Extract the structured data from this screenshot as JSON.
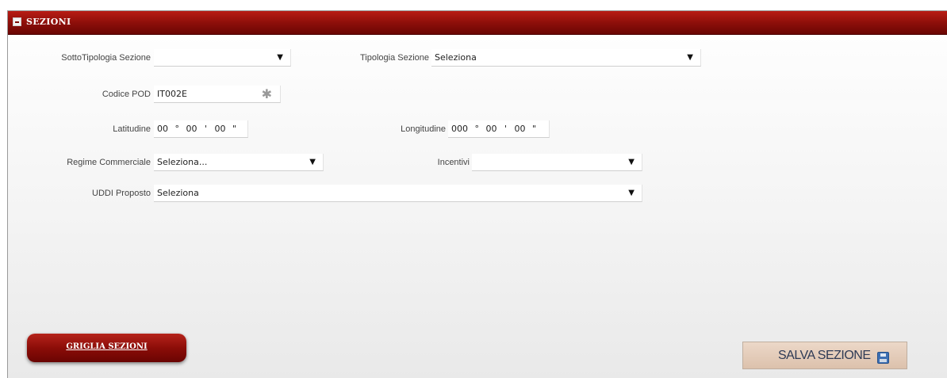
{
  "section": {
    "title": "SEZIONI",
    "icon": "collapse-icon"
  },
  "form": {
    "sottotipologia": {
      "label": "SottoTipologia Sezione",
      "value": ""
    },
    "tipologia": {
      "label": "Tipologia Sezione",
      "value": "Seleziona"
    },
    "codice_pod": {
      "label": "Codice POD",
      "value": "IT002E",
      "required_icon": "asterisk-icon"
    },
    "latitudine": {
      "label": "Latitudine",
      "deg": "00",
      "deg_symbol": "°",
      "min": "00",
      "min_symbol": "'",
      "sec": "00",
      "sec_symbol": "\""
    },
    "longitudine": {
      "label": "Longitudine",
      "deg": "000",
      "deg_symbol": "°",
      "min": "00",
      "min_symbol": "'",
      "sec": "00",
      "sec_symbol": "\""
    },
    "regime_commerciale": {
      "label": "Regime Commerciale",
      "value": "Seleziona..."
    },
    "incentivi": {
      "label": "Incentivi",
      "value": ""
    },
    "uddi_proposto": {
      "label": "UDDI Proposto",
      "value": "Seleziona"
    },
    "dropdown_arrow": "▼"
  },
  "buttons": {
    "griglia": "GRIGLIA SEZIONI",
    "salva": "SALVA SEZIONE",
    "salva_icon": "floppy-disk-icon"
  },
  "colors": {
    "header": "#8e0f0a",
    "griglia_button": "#8c0d08",
    "salva_button": "#dcc1ac"
  }
}
